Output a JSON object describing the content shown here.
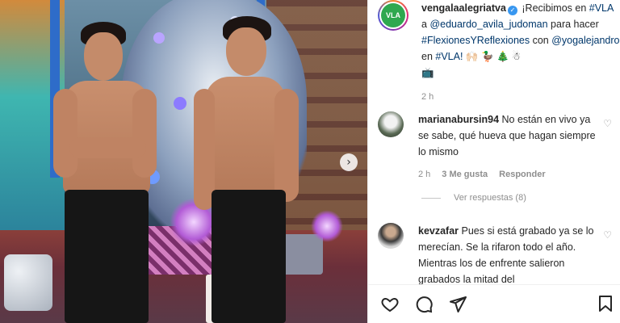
{
  "post": {
    "username": "vengalaalegriatva",
    "caption_intro": " ¡Recibimos en ",
    "hashtag_vla": "#VLA",
    "caption_a": " a ",
    "mention_eduardo": "@eduardo_avila_judoman",
    "caption_para": " para hacer ",
    "hashtag_flex": "#FlexionesYReflexiones",
    "caption_con": " con ",
    "mention_yoga": "@yogalejandro",
    "caption_en": " en ",
    "hashtag_vla2": "#VLA!",
    "caption_emojis": " 🙌🏻 🦆 🎄 ☃",
    "caption_tv": "📺",
    "time": "2 h",
    "avatar_text": "VLA"
  },
  "comments": [
    {
      "username": "marianabursin94",
      "text": " No están en vivo ya se sabe, qué hueva que hagan siempre lo mismo",
      "time": "2 h",
      "likes": "3 Me gusta",
      "reply": "Responder"
    },
    {
      "username": "kevzafar",
      "text": " Pues si está grabado ya se lo merecían. Se la rifaron todo el año. Mientras los de enfrente salieron grabados la mitad del"
    }
  ],
  "view_replies": "Ver respuestas (8)",
  "icons": {
    "heart": "heart-icon",
    "comment": "comment-icon",
    "share": "share-icon",
    "bookmark": "bookmark-icon",
    "next": "chevron-right-icon"
  },
  "colors": {
    "link": "#00376b",
    "meta": "#8e8e8e",
    "verified": "#3897f0"
  }
}
